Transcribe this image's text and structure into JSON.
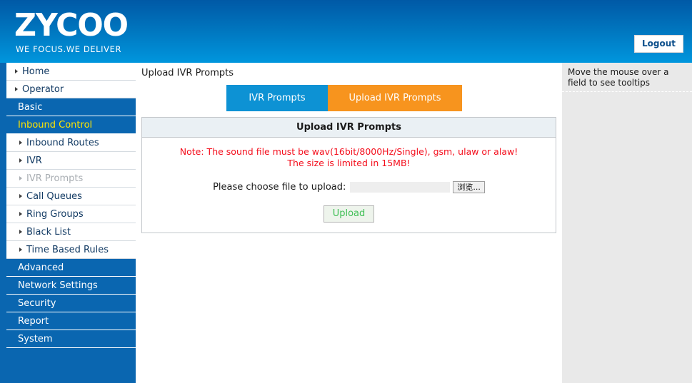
{
  "header": {
    "logo_text": "ZYCOO",
    "logo_tagline": "WE FOCUS.WE DELIVER",
    "logout_label": "Logout",
    "gradient_top": "#0059a6",
    "gradient_bottom": "#0096dd"
  },
  "sidebar": {
    "top_items": [
      {
        "label": "Home"
      },
      {
        "label": "Operator"
      }
    ],
    "sections": [
      {
        "label": "Basic",
        "active": false
      },
      {
        "label": "Inbound Control",
        "active": true
      }
    ],
    "sub_items": [
      {
        "label": "Inbound Routes",
        "disabled": false
      },
      {
        "label": "IVR",
        "disabled": false
      },
      {
        "label": "IVR Prompts",
        "disabled": true
      },
      {
        "label": "Call Queues",
        "disabled": false
      },
      {
        "label": "Ring Groups",
        "disabled": false
      },
      {
        "label": "Black List",
        "disabled": false
      },
      {
        "label": "Time Based Rules",
        "disabled": false
      }
    ],
    "bottom_sections": [
      {
        "label": "Advanced"
      },
      {
        "label": "Network Settings"
      },
      {
        "label": "Security"
      },
      {
        "label": "Report"
      },
      {
        "label": "System"
      }
    ],
    "bg_color": "#0a66b0",
    "active_color": "#ffe400"
  },
  "main": {
    "page_title": "Upload IVR Prompts",
    "tabs": [
      {
        "label": "IVR Prompts",
        "color": "#0d92d4",
        "selected": false
      },
      {
        "label": "Upload IVR Prompts",
        "color": "#f7941e",
        "selected": true
      }
    ],
    "panel": {
      "heading": "Upload IVR Prompts",
      "note_line1": "Note: The sound file must be wav(16bit/8000Hz/Single), gsm, ulaw or alaw!",
      "note_line2": "The size is limited in 15MB!",
      "note_color": "#f40e1c",
      "file_label": "Please choose file to upload:",
      "file_value": "",
      "browse_label": "浏览...",
      "upload_label": "Upload",
      "upload_text_color": "#3fbf55"
    }
  },
  "tips": {
    "text": "Move the mouse over a field to see tooltips"
  }
}
